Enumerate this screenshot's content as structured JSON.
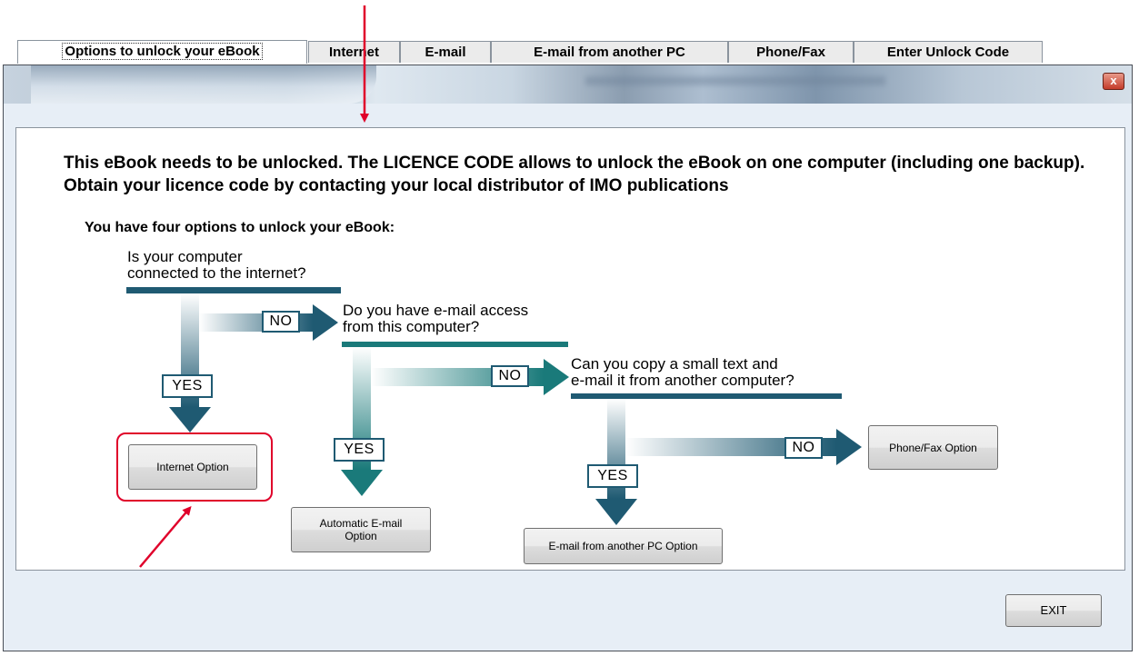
{
  "window": {
    "close_label": "x"
  },
  "tabs": [
    {
      "label": "Options to unlock your eBook",
      "active": true
    },
    {
      "label": "Internet",
      "active": false
    },
    {
      "label": "E-mail",
      "active": false
    },
    {
      "label": "E-mail from another PC",
      "active": false
    },
    {
      "label": "Phone/Fax",
      "active": false
    },
    {
      "label": "Enter Unlock Code",
      "active": false
    }
  ],
  "notice": "This eBook needs to be unlocked. The LICENCE CODE allows to unlock the eBook on one computer (including one backup). Obtain your licence code by contacting your local distributor of IMO publications",
  "subtitle": "You have four options to unlock your eBook:",
  "flow": {
    "q1": "Is your computer\nconnected to the internet?",
    "q2": "Do you have e-mail access\nfrom this computer?",
    "q3": "Can you copy a small text and\ne-mail it from another computer?",
    "yes": "YES",
    "no": "NO"
  },
  "buttons": {
    "internet": "Internet Option",
    "auto_email": "Automatic E-mail\nOption",
    "email_other_pc": "E-mail from another PC Option",
    "phone_fax": "Phone/Fax Option",
    "exit": "EXIT"
  },
  "colors": {
    "flow_dark": "#1f5a72",
    "flow_teal": "#1a7a7a",
    "annotation_red": "#e0002a"
  }
}
